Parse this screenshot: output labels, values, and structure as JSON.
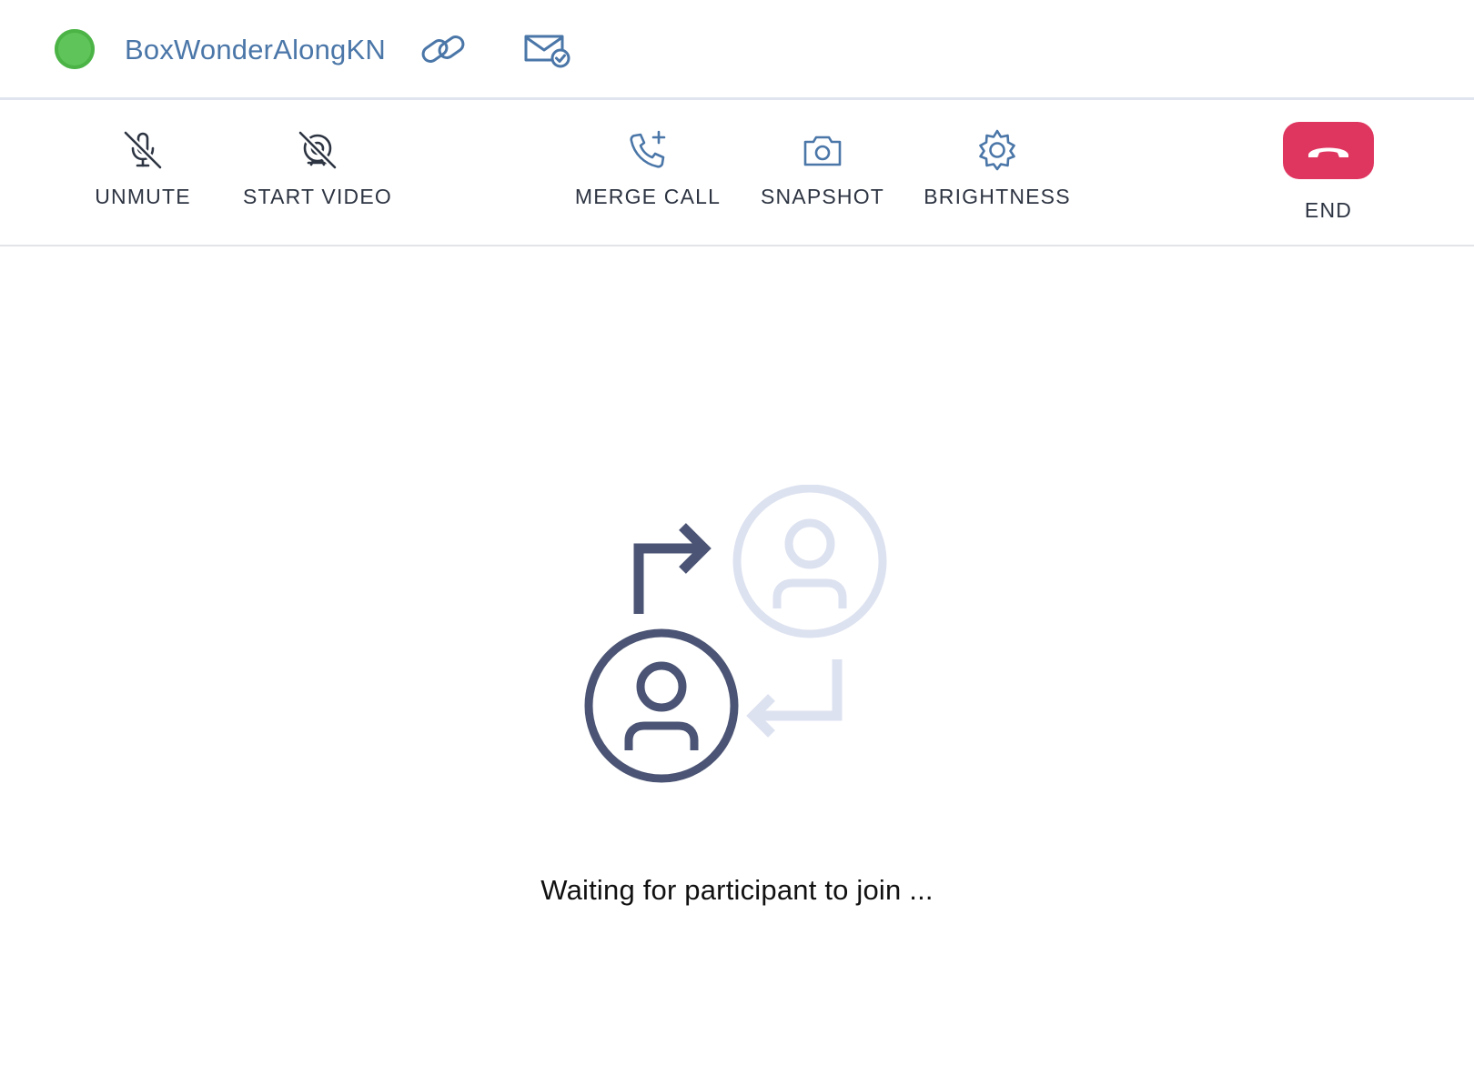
{
  "header": {
    "status": {
      "state": "online",
      "color": "#5fc55a"
    },
    "room_name": "BoxWonderAlongKN",
    "icons": [
      "link-icon",
      "mail-check-icon"
    ]
  },
  "toolbar": {
    "items": [
      {
        "label": "UNMUTE",
        "icon": "mic-off-icon"
      },
      {
        "label": "START VIDEO",
        "icon": "video-off-icon"
      },
      {
        "label": "MERGE CALL",
        "icon": "phone-add-icon"
      },
      {
        "label": "SNAPSHOT",
        "icon": "camera-icon"
      },
      {
        "label": "BRIGHTNESS",
        "icon": "brightness-icon"
      },
      {
        "label": "END",
        "icon": "hang-up-icon",
        "color": "#df3660"
      }
    ]
  },
  "main": {
    "illustration": "participant-transfer-illustration",
    "message": "Waiting for participant to join ..."
  },
  "colors": {
    "accent": "#4a76a8",
    "icon_dark": "#4b5474",
    "icon_light": "#dde2f0",
    "end_red": "#df3660"
  }
}
